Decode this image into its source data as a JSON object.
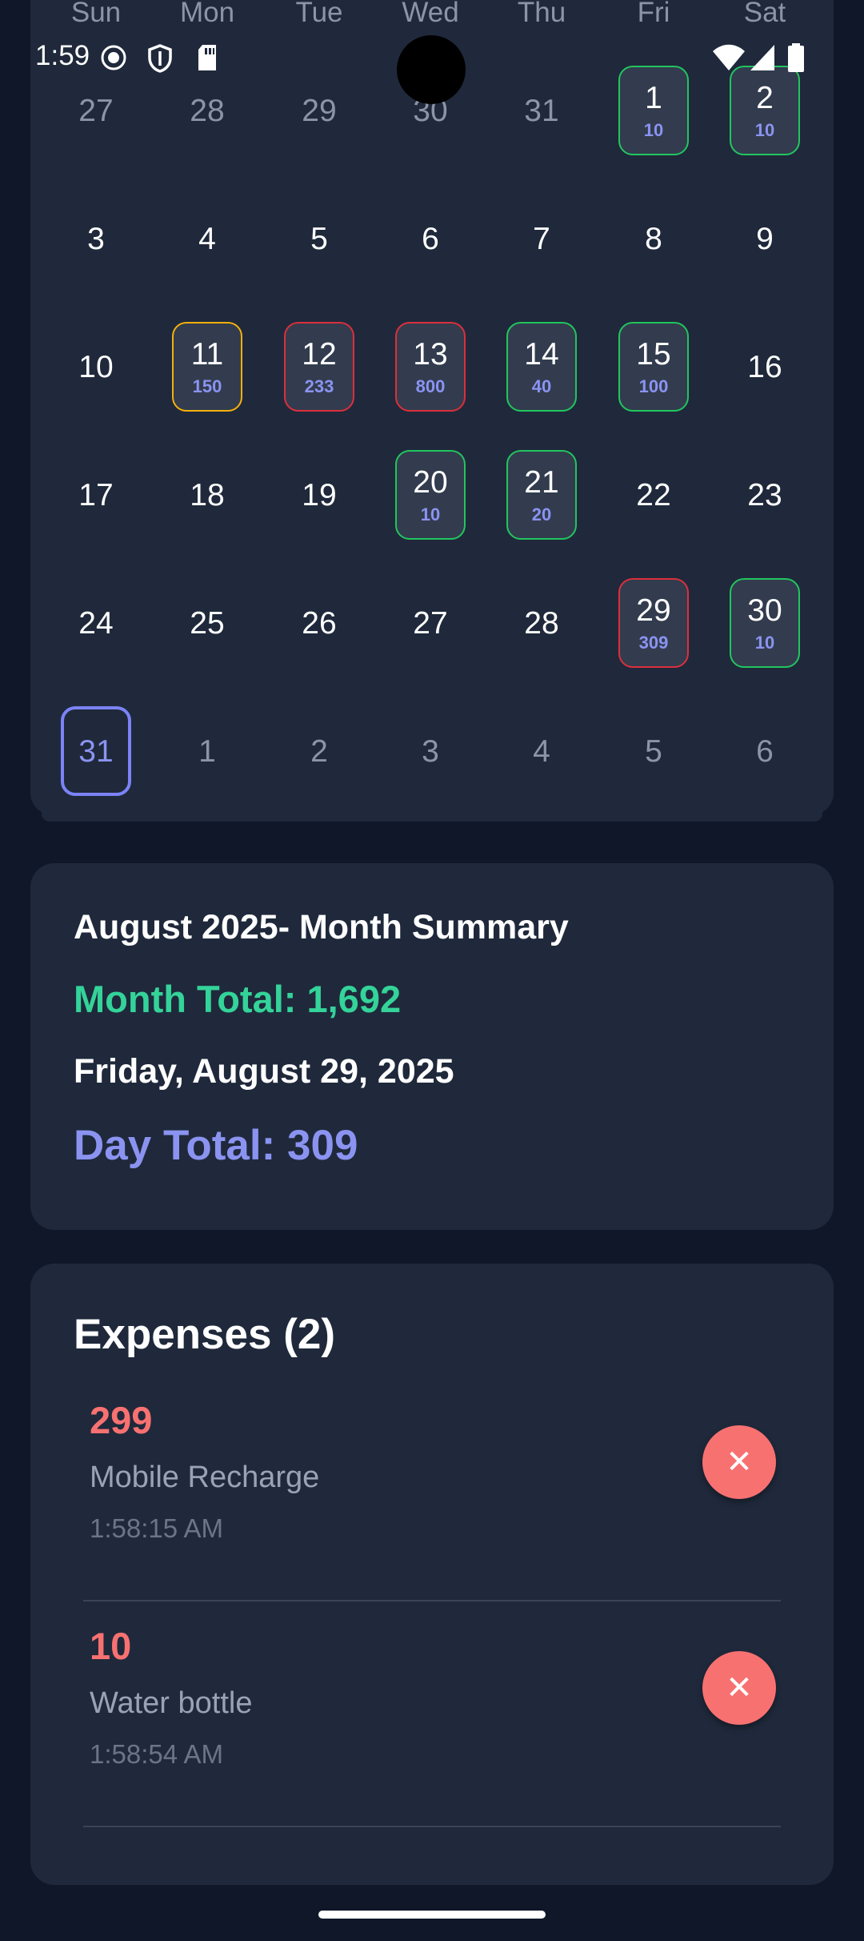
{
  "status_bar": {
    "time": "1:59"
  },
  "calendar": {
    "weekdays": [
      "Sun",
      "Mon",
      "Tue",
      "Wed",
      "Thu",
      "Fri",
      "Sat"
    ],
    "weeks": [
      [
        {
          "day": "27",
          "state": "other"
        },
        {
          "day": "28",
          "state": "other"
        },
        {
          "day": "29",
          "state": "other"
        },
        {
          "day": "30",
          "state": "other"
        },
        {
          "day": "31",
          "state": "other"
        },
        {
          "day": "1",
          "state": "green",
          "amount": "10"
        },
        {
          "day": "2",
          "state": "green",
          "amount": "10"
        }
      ],
      [
        {
          "day": "3",
          "state": "plain"
        },
        {
          "day": "4",
          "state": "plain"
        },
        {
          "day": "5",
          "state": "plain"
        },
        {
          "day": "6",
          "state": "plain"
        },
        {
          "day": "7",
          "state": "plain"
        },
        {
          "day": "8",
          "state": "plain"
        },
        {
          "day": "9",
          "state": "plain"
        }
      ],
      [
        {
          "day": "10",
          "state": "plain"
        },
        {
          "day": "11",
          "state": "orange",
          "amount": "150"
        },
        {
          "day": "12",
          "state": "red",
          "amount": "233"
        },
        {
          "day": "13",
          "state": "red",
          "amount": "800"
        },
        {
          "day": "14",
          "state": "green",
          "amount": "40"
        },
        {
          "day": "15",
          "state": "green",
          "amount": "100"
        },
        {
          "day": "16",
          "state": "plain"
        }
      ],
      [
        {
          "day": "17",
          "state": "plain"
        },
        {
          "day": "18",
          "state": "plain"
        },
        {
          "day": "19",
          "state": "plain"
        },
        {
          "day": "20",
          "state": "green",
          "amount": "10"
        },
        {
          "day": "21",
          "state": "green",
          "amount": "20"
        },
        {
          "day": "22",
          "state": "plain"
        },
        {
          "day": "23",
          "state": "plain"
        }
      ],
      [
        {
          "day": "24",
          "state": "plain"
        },
        {
          "day": "25",
          "state": "plain"
        },
        {
          "day": "26",
          "state": "plain"
        },
        {
          "day": "27",
          "state": "plain"
        },
        {
          "day": "28",
          "state": "plain"
        },
        {
          "day": "29",
          "state": "red",
          "amount": "309"
        },
        {
          "day": "30",
          "state": "green",
          "amount": "10"
        }
      ],
      [
        {
          "day": "31",
          "state": "today"
        },
        {
          "day": "1",
          "state": "other"
        },
        {
          "day": "2",
          "state": "other"
        },
        {
          "day": "3",
          "state": "other"
        },
        {
          "day": "4",
          "state": "other"
        },
        {
          "day": "5",
          "state": "other"
        },
        {
          "day": "6",
          "state": "other"
        }
      ]
    ]
  },
  "summary": {
    "title": "August 2025- Month Summary",
    "month_total": "Month Total: 1,692",
    "selected_date": "Friday, August 29, 2025",
    "day_total": "Day Total: 309"
  },
  "expenses": {
    "heading": "Expenses (2)",
    "items": [
      {
        "amount": "299",
        "description": "Mobile Recharge",
        "time": "1:58:15 AM"
      },
      {
        "amount": "10",
        "description": "Water bottle",
        "time": "1:58:54 AM"
      }
    ]
  },
  "colors": {
    "background": "#0f1729",
    "card": "#1f293b",
    "green": "#22c55e",
    "red": "#dc2f3c",
    "orange": "#f5b00b",
    "accent": "#8b93f1",
    "expense_amount": "#f87171"
  }
}
